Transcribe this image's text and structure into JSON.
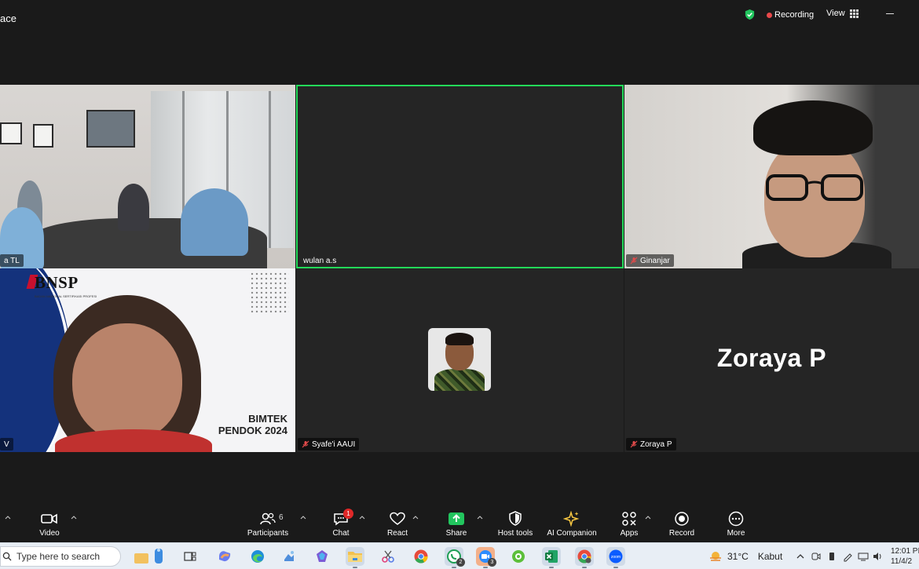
{
  "window": {
    "title": "ace",
    "recording_label": "Recording",
    "view_label": "View"
  },
  "tiles": [
    {
      "name": "a TL",
      "kind": "video",
      "muted": false
    },
    {
      "name": "wulan a.s",
      "kind": "video-off",
      "muted": false,
      "active_speaker": true
    },
    {
      "name": "Ginanjar",
      "kind": "video",
      "muted": true
    },
    {
      "name": "V",
      "kind": "video",
      "muted": false
    },
    {
      "name": "Syafe'i AAUI",
      "kind": "avatar",
      "muted": true
    },
    {
      "name": "Zoraya P",
      "kind": "name-only",
      "muted": true,
      "big_name": "Zoraya P"
    }
  ],
  "slide": {
    "logo": "BNSP",
    "subtitle": "BADAN NASIONAL SERTIFIKASI PROFESI",
    "line1": "BIMTEK",
    "line2": "PENDOK 2024"
  },
  "toolbar": {
    "video_label": "Video",
    "participants_label": "Participants",
    "participants_count": "6",
    "chat_label": "Chat",
    "chat_badge": "1",
    "react_label": "React",
    "share_label": "Share",
    "host_tools_label": "Host tools",
    "ai_companion_label": "AI Companion",
    "apps_label": "Apps",
    "record_label": "Record",
    "more_label": "More"
  },
  "taskbar": {
    "search_placeholder": "Type here to search",
    "whatsapp_badge": "2",
    "zoom_badge": "3",
    "temperature": "31°C",
    "weather_text": "Kabut",
    "time": "12:01 PI",
    "date": "11/4/2"
  },
  "colors": {
    "background": "#1a1a1a",
    "active_speaker": "#23d959",
    "share_green": "#22c55e",
    "recording_red": "#e8484a",
    "badge_red": "#e02828"
  }
}
